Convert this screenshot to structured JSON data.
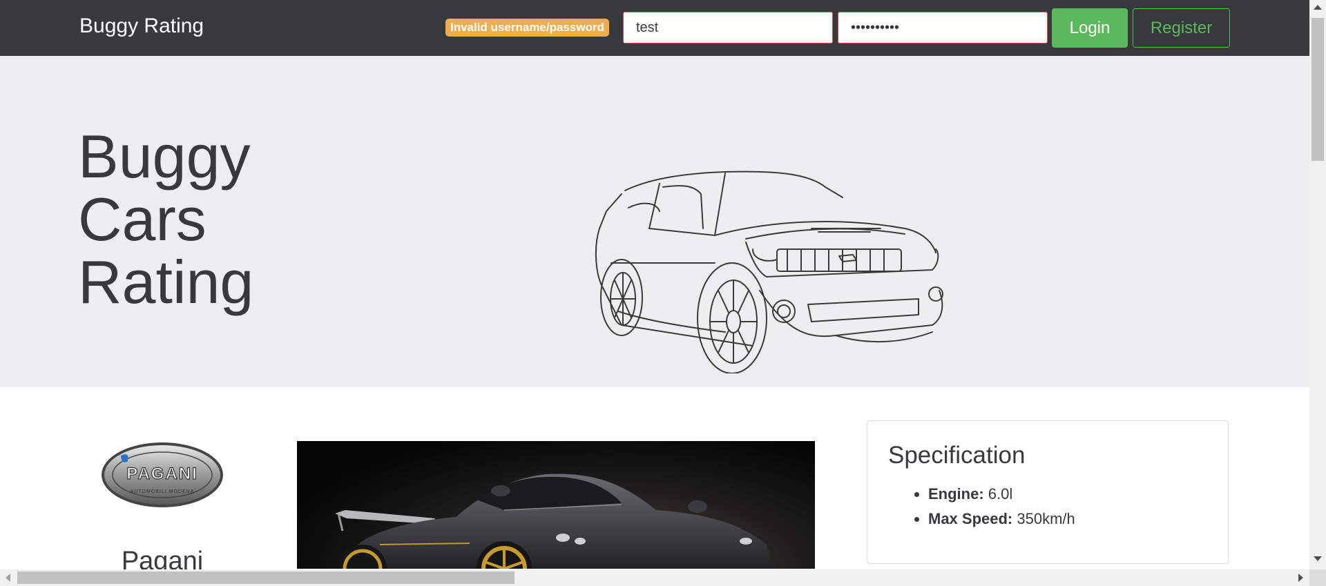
{
  "nav": {
    "brand": "Buggy Rating",
    "error_badge": "Invalid username/password",
    "username_value": "test",
    "password_value": "••••••••••",
    "login_label": "Login",
    "register_label": "Register"
  },
  "hero": {
    "title_lines": [
      "Buggy",
      "Cars",
      "Rating"
    ],
    "image_icon": "car-sketch-icon"
  },
  "make": {
    "logo_text": "PAGANI",
    "logo_subtext": "AUTOMOBILI MODENA",
    "name": "Pagani"
  },
  "spec": {
    "title": "Specification",
    "items": [
      {
        "label": "Engine:",
        "value": "6.0l"
      },
      {
        "label": "Max Speed:",
        "value": "350km/h"
      }
    ]
  },
  "colors": {
    "navbar": "#373a3c",
    "jumbotron": "#eceeef",
    "success": "#5cb85c",
    "warning": "#f0ad4e",
    "danger": "#d9534f"
  }
}
